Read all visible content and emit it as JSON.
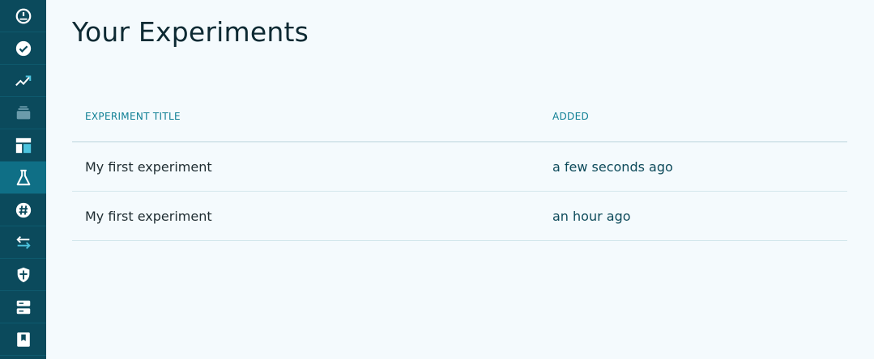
{
  "sidebar": {
    "items": [
      {
        "icon": "speedometer-icon",
        "active": false
      },
      {
        "icon": "check-circle-icon",
        "active": false
      },
      {
        "icon": "trending-up-icon",
        "active": false
      },
      {
        "icon": "stack-icon",
        "active": false
      },
      {
        "icon": "layout-icon",
        "active": false
      },
      {
        "icon": "flask-icon",
        "active": true
      },
      {
        "icon": "hashtag-icon",
        "active": false
      },
      {
        "icon": "swap-arrows-icon",
        "active": false
      },
      {
        "icon": "shield-icon",
        "active": false
      },
      {
        "icon": "server-icon",
        "active": false
      },
      {
        "icon": "bookmark-icon",
        "active": false
      }
    ]
  },
  "header": {
    "title": "Your Experiments"
  },
  "table": {
    "columns": [
      "Experiment Title",
      "Added"
    ],
    "rows": [
      {
        "title": "My first experiment",
        "added": "a few seconds ago"
      },
      {
        "title": "My first experiment",
        "added": "an hour ago"
      }
    ]
  },
  "colors": {
    "sidebar_bg": "#0b4a5c",
    "sidebar_active": "#0f6f86",
    "accent": "#0f7f94",
    "page_bg": "#f4fafd"
  }
}
